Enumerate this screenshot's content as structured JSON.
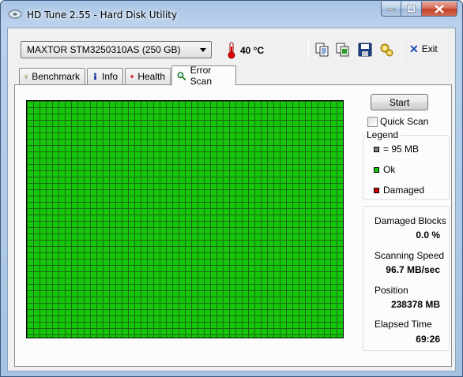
{
  "window": {
    "title": "HD Tune 2.55 - Hard Disk Utility"
  },
  "toolbar": {
    "drive": "MAXTOR STM3250310AS (250 GB)",
    "temperature": "40 °C",
    "exit_label": "Exit",
    "icons": [
      "copy-text-icon",
      "copy-screenshot-icon",
      "save-icon",
      "options-icon"
    ]
  },
  "tabs": [
    {
      "label": "Benchmark",
      "icon": "bulb-icon"
    },
    {
      "label": "Info",
      "icon": "info-icon"
    },
    {
      "label": "Health",
      "icon": "health-cross-icon"
    },
    {
      "label": "Error Scan",
      "icon": "magnifier-icon",
      "active": true
    }
  ],
  "scan": {
    "start_label": "Start",
    "quick_scan_label": "Quick Scan",
    "quick_scan_checked": false,
    "grid_state": "ok",
    "colors": {
      "ok": "#16c60a",
      "damaged": "#d10000",
      "block": "#808080"
    }
  },
  "legend": {
    "title": "Legend",
    "items": [
      {
        "label": "= 95 MB",
        "color": "#808080"
      },
      {
        "label": "Ok",
        "color": "#16c60a"
      },
      {
        "label": "Damaged",
        "color": "#d10000"
      }
    ]
  },
  "stats": {
    "damaged_blocks_label": "Damaged Blocks",
    "damaged_blocks_value": "0.0 %",
    "scanning_speed_label": "Scanning Speed",
    "scanning_speed_value": "96.7 MB/sec",
    "position_label": "Position",
    "position_value": "238378 MB",
    "elapsed_time_label": "Elapsed Time",
    "elapsed_time_value": "69:26"
  }
}
